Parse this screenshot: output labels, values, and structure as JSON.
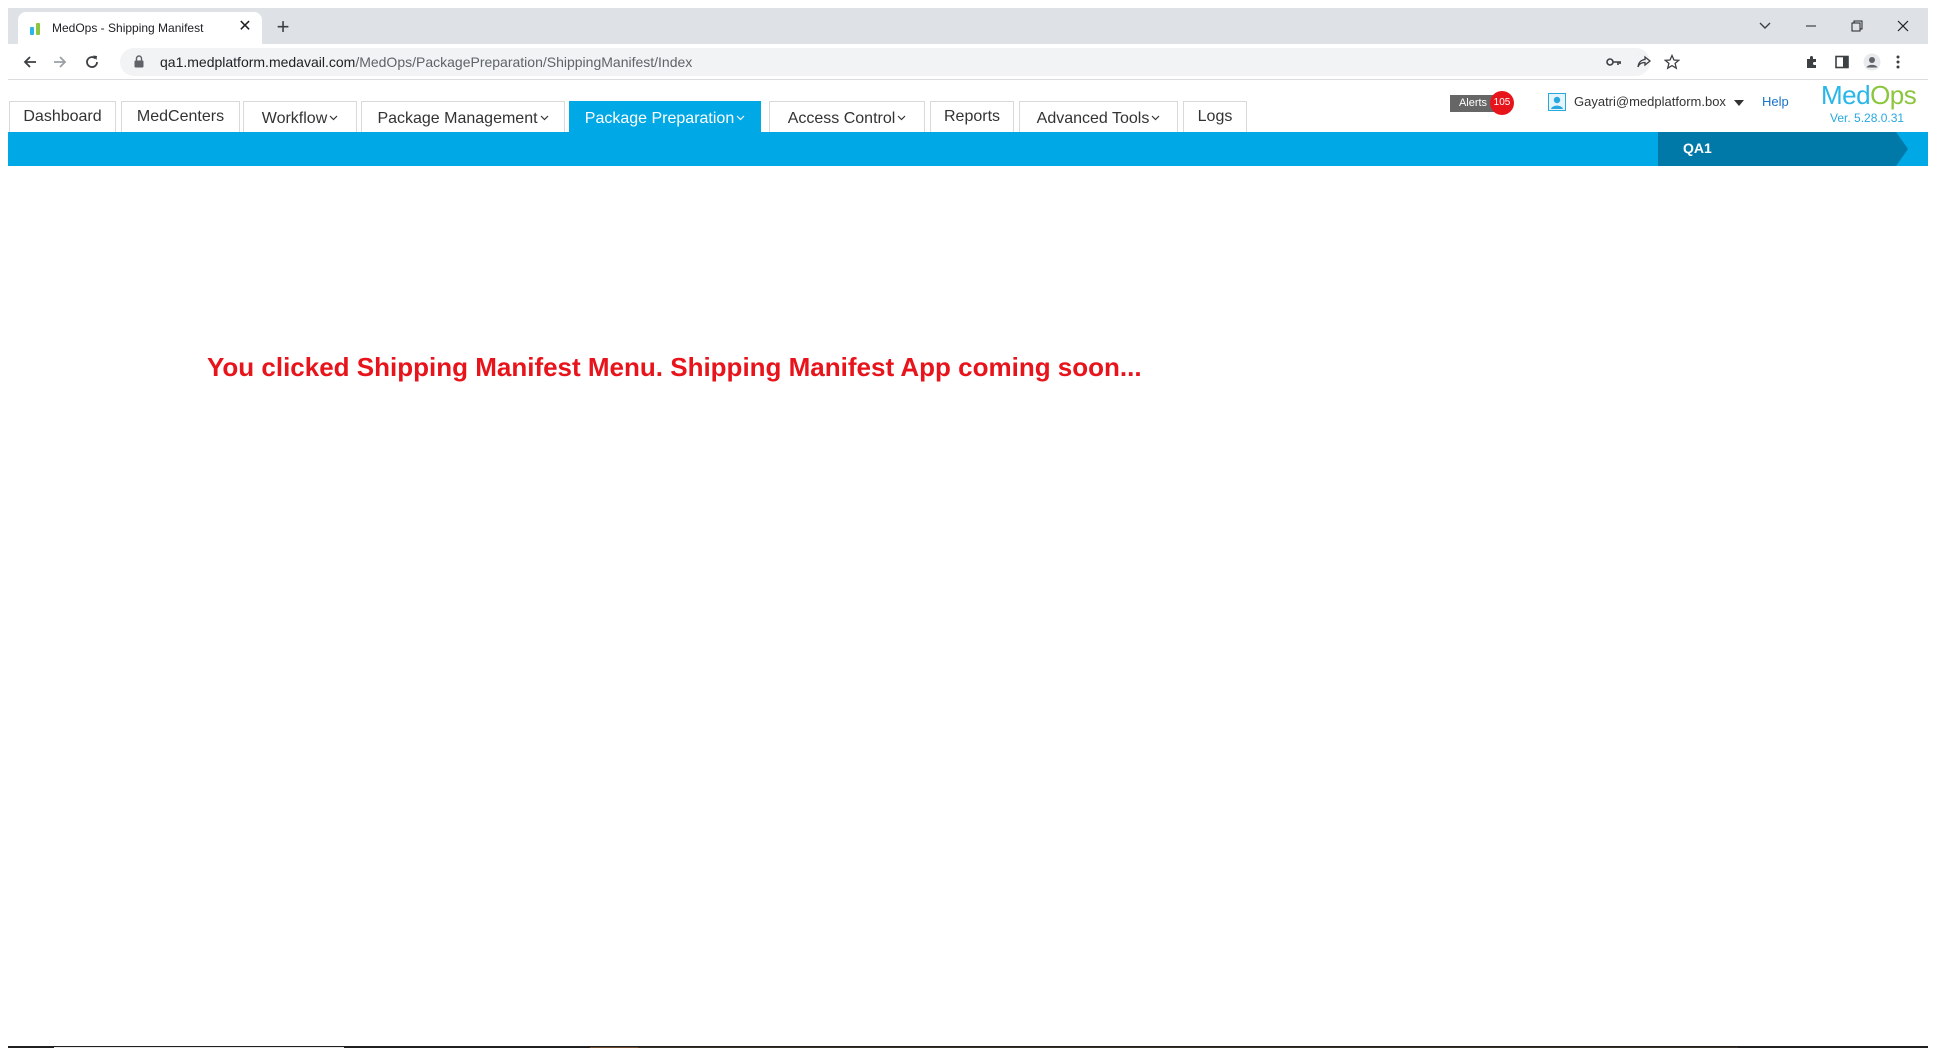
{
  "browser": {
    "tab_title": "MedOps - Shipping Manifest",
    "url_host": "qa1.medplatform.medavail.com",
    "url_path": "/MedOps/PackagePreparation/ShippingManifest/Index"
  },
  "nav": {
    "items": [
      {
        "label": "Dashboard",
        "has_dropdown": false
      },
      {
        "label": "MedCenters",
        "has_dropdown": false
      },
      {
        "label": "Workflow",
        "has_dropdown": true
      },
      {
        "label": "Package Management",
        "has_dropdown": true
      },
      {
        "label": "Package Preparation",
        "has_dropdown": true,
        "active": true
      },
      {
        "label": "Access Control",
        "has_dropdown": true
      },
      {
        "label": "Reports",
        "has_dropdown": false
      },
      {
        "label": "Advanced Tools",
        "has_dropdown": true
      },
      {
        "label": "Logs",
        "has_dropdown": false
      }
    ]
  },
  "header": {
    "alerts_label": "Alerts",
    "alerts_count": "105",
    "user_email": "Gayatri@medplatform.box",
    "help_label": "Help",
    "logo_text_a": "Med",
    "logo_text_b": "Ops",
    "version": "Ver. 5.28.0.31"
  },
  "environment": {
    "label": "QA1"
  },
  "main": {
    "message": "You clicked Shipping Manifest Menu. Shipping Manifest App coming soon..."
  },
  "colors": {
    "accent": "#00a8e6",
    "env": "#0079a8",
    "message": "#e8141b",
    "alert_badge": "#e8141b"
  }
}
